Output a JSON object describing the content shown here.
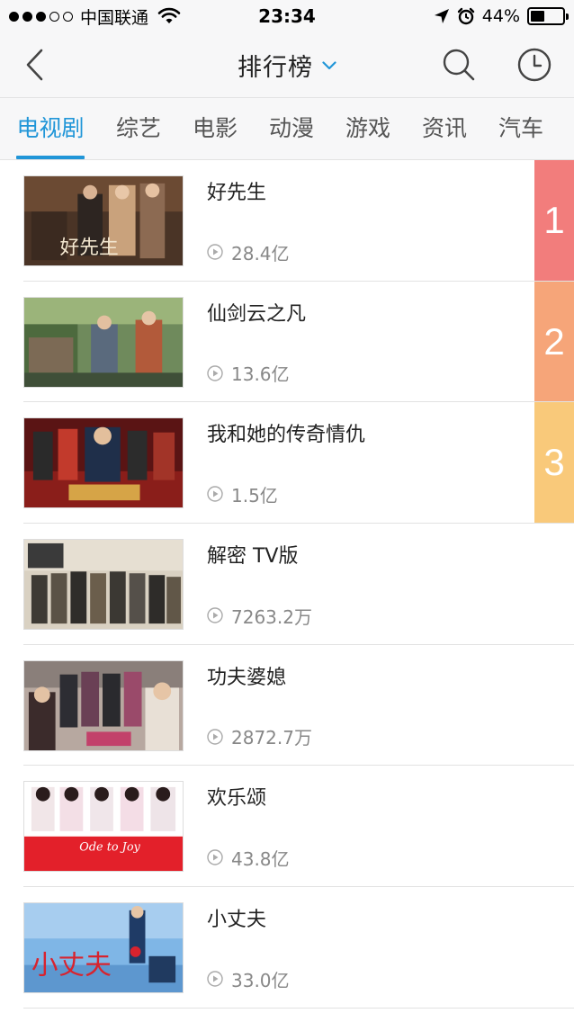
{
  "status_bar": {
    "carrier": "中国联通",
    "time": "23:34",
    "battery_percent": "44%",
    "battery_level": 0.44,
    "signal_icons": [
      "signal-dots-icon",
      "wifi-icon",
      "location-arrow-icon",
      "alarm-clock-icon",
      "battery-icon"
    ]
  },
  "nav": {
    "title": "排行榜",
    "icons": [
      "back-chevron-icon",
      "title-dropdown-chevron-icon",
      "search-icon",
      "history-clock-icon"
    ],
    "accent_color": "#2196d8"
  },
  "tabs": [
    {
      "label": "电视剧",
      "active": true
    },
    {
      "label": "综艺",
      "active": false
    },
    {
      "label": "电影",
      "active": false
    },
    {
      "label": "动漫",
      "active": false
    },
    {
      "label": "游戏",
      "active": false
    },
    {
      "label": "资讯",
      "active": false
    },
    {
      "label": "汽车",
      "active": false
    }
  ],
  "rankings": [
    {
      "rank": "1",
      "title": "好先生",
      "plays": "28.4亿",
      "badge_color": "#f27d7c"
    },
    {
      "rank": "2",
      "title": "仙剑云之凡",
      "plays": "13.6亿",
      "badge_color": "#f6a579"
    },
    {
      "rank": "3",
      "title": "我和她的传奇情仇",
      "plays": "1.5亿",
      "badge_color": "#f9c97a"
    },
    {
      "rank": "",
      "title": "解密 TV版",
      "plays": "7263.2万",
      "badge_color": ""
    },
    {
      "rank": "",
      "title": "功夫婆媳",
      "plays": "2872.7万",
      "badge_color": ""
    },
    {
      "rank": "",
      "title": "欢乐颂",
      "plays": "43.8亿",
      "badge_color": ""
    },
    {
      "rank": "",
      "title": "小丈夫",
      "plays": "33.0亿",
      "badge_color": ""
    }
  ],
  "poster_logo_text": [
    "好先生",
    "Ode to Joy",
    "小丈夫"
  ]
}
